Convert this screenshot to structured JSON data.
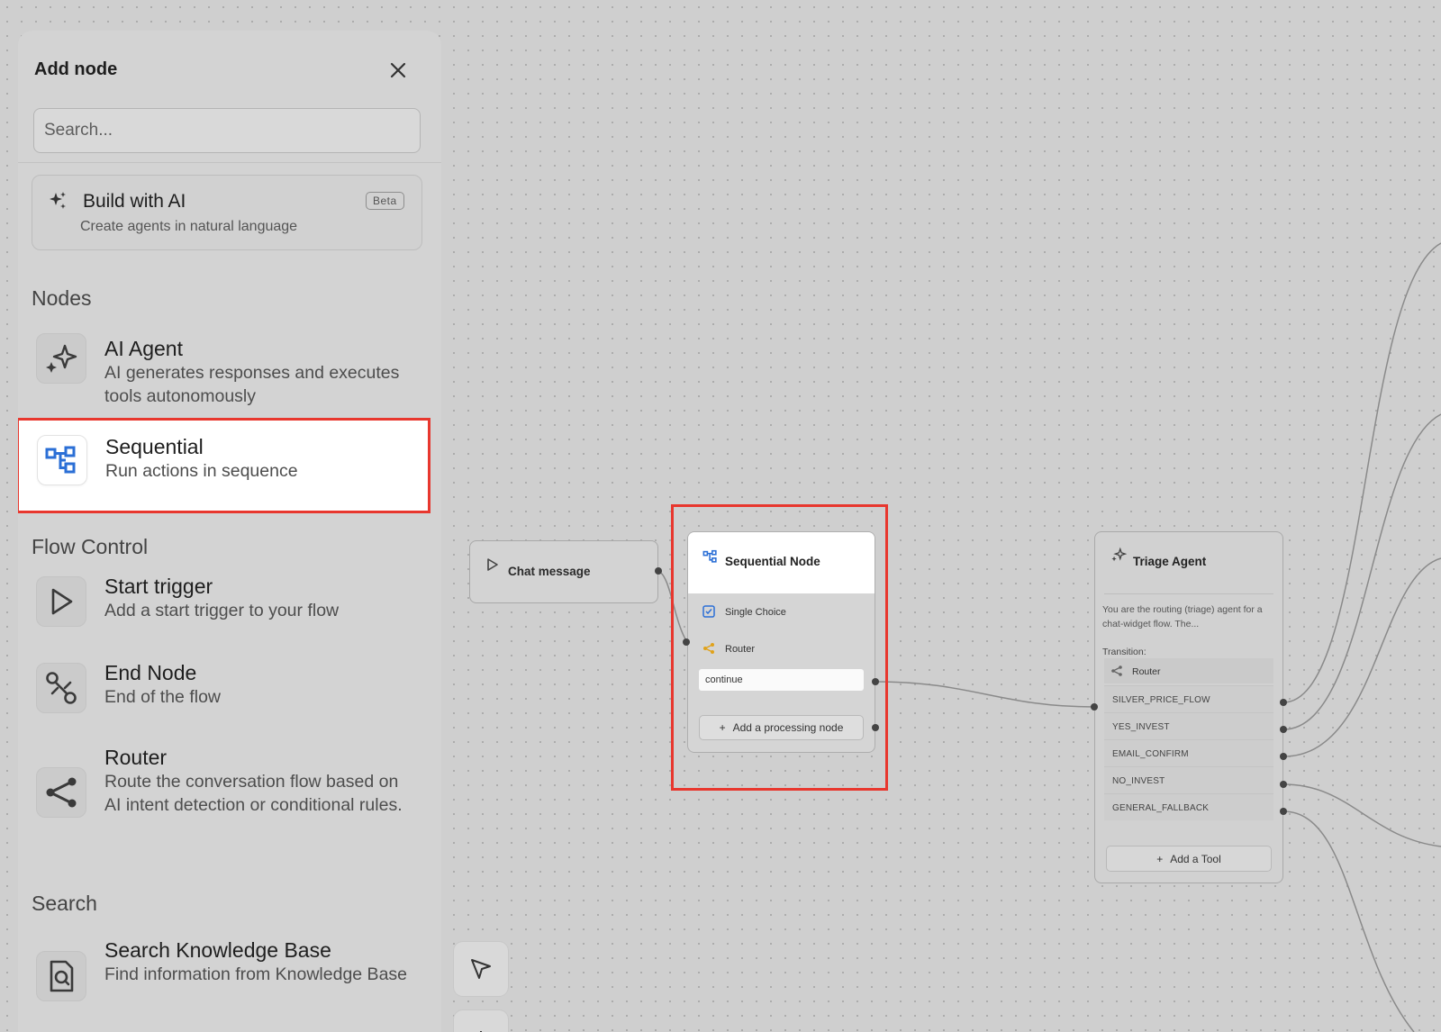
{
  "panel": {
    "title": "Add node",
    "search_placeholder": "Search...",
    "build_ai": {
      "title": "Build with AI",
      "description": "Create agents in natural language",
      "badge": "Beta"
    },
    "sections": {
      "nodes": "Nodes",
      "flow_control": "Flow Control",
      "search": "Search"
    },
    "items": [
      {
        "title": "AI Agent",
        "description": "AI generates responses and executes tools autonomously",
        "icon": "sparkle-icon"
      },
      {
        "title": "Sequential",
        "description": "Run actions in sequence",
        "icon": "sequential-icon"
      },
      {
        "title": "Start trigger",
        "description": "Add a start trigger to your flow",
        "icon": "play-icon"
      },
      {
        "title": "End Node",
        "description": "End of the flow",
        "icon": "route-end-icon"
      },
      {
        "title": "Router",
        "description": "Route the conversation flow based on AI intent detection or conditional rules.",
        "icon": "share-icon"
      },
      {
        "title": "Search Knowledge Base",
        "description": "Find information from Knowledge Base",
        "icon": "file-search-icon"
      }
    ]
  },
  "canvas": {
    "chat_node": {
      "label": "Chat message"
    },
    "sequential_node": {
      "title": "Sequential Node",
      "steps": [
        {
          "label": "Single Choice",
          "icon": "checkbox-icon"
        },
        {
          "label": "Router",
          "icon": "share-icon"
        }
      ],
      "output": "continue",
      "add_button": "Add a processing node"
    },
    "triage_node": {
      "title": "Triage Agent",
      "description": "You are the routing (triage) agent for a chat-widget flow. The...",
      "transition_label": "Transition:",
      "router_label": "Router",
      "routes": [
        "SILVER_PRICE_FLOW",
        "YES_INVEST",
        "EMAIL_CONFIRM",
        "NO_INVEST",
        "GENERAL_FALLBACK"
      ],
      "add_button": "Add a Tool"
    }
  },
  "colors": {
    "highlight": "#e8372e",
    "accent_blue": "#2b6fd6",
    "router_orange": "#e0a21b",
    "canvas_bg": "#cfcfcf"
  }
}
